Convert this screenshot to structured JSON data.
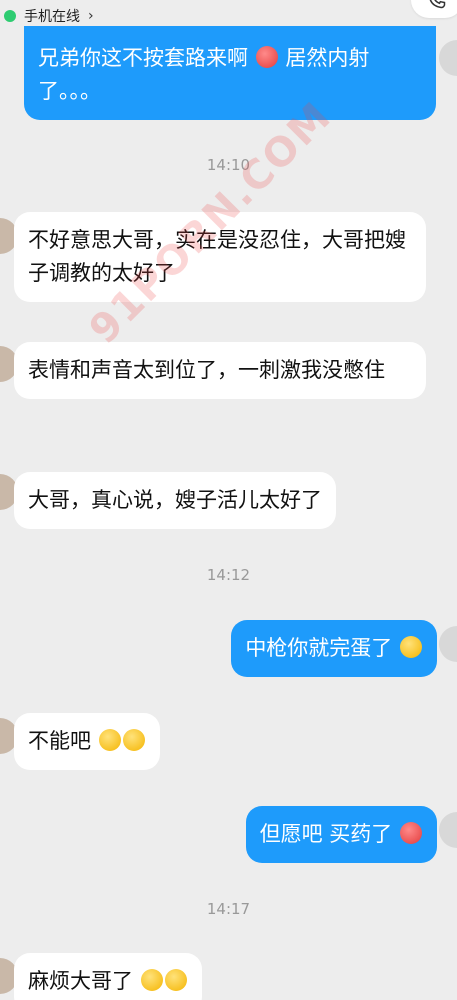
{
  "status": {
    "text": "手机在线",
    "chevron": "›",
    "online_color": "#2ecc71"
  },
  "call": {
    "icon": "phone-icon"
  },
  "watermark": {
    "text": "91PORN.COM"
  },
  "messages": [
    {
      "side": "out",
      "text": "兄弟你这不按套路来啊",
      "emoji": "flushed-red",
      "text2": "居然内射了。。。"
    },
    {
      "time": "14:10"
    },
    {
      "side": "in",
      "text": "不好意思大哥，实在是没忍住，大哥把嫂子调教的太好了"
    },
    {
      "side": "in",
      "text": "表情和声音太到位了，一刺激我没憋住"
    },
    {
      "side": "in",
      "text": "大哥，真心说，嫂子活儿太好了"
    },
    {
      "time": "14:12"
    },
    {
      "side": "out",
      "text": "中枪你就完蛋了",
      "emoji": "smirk"
    },
    {
      "side": "in",
      "text": "不能吧",
      "emoji": "laugh-cry x2"
    },
    {
      "side": "out",
      "text": "但愿吧 买药了",
      "emoji": "flushed-red"
    },
    {
      "time": "14:17"
    },
    {
      "side": "in",
      "text": "麻烦大哥了",
      "emoji": "teary x2"
    }
  ],
  "colors": {
    "outgoing": "#1e9bfb",
    "incoming": "#ffffff",
    "background": "#ededed"
  }
}
